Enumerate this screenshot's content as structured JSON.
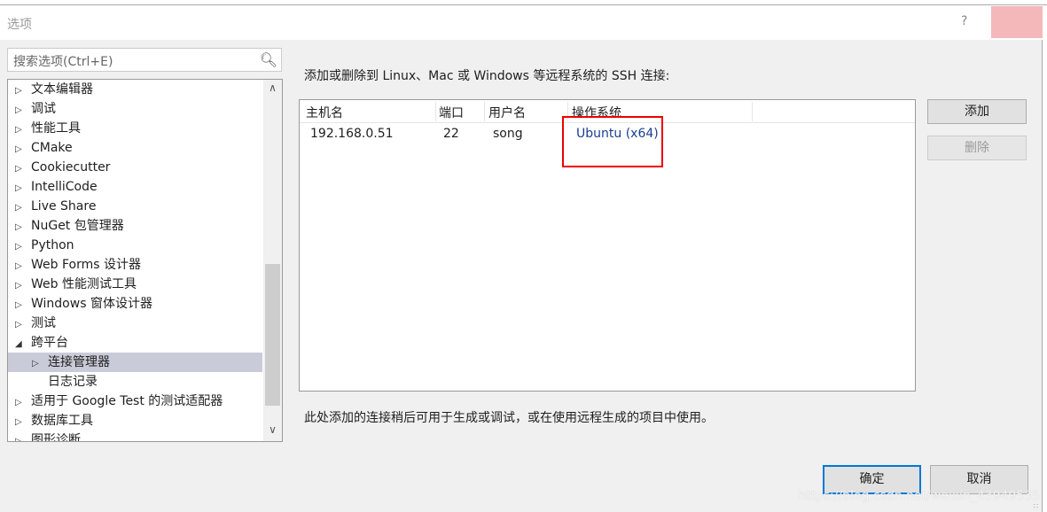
{
  "window": {
    "title": "选项",
    "help": "?"
  },
  "search": {
    "placeholder": "搜索选项(Ctrl+E)"
  },
  "tree": [
    {
      "label": "文本编辑器",
      "level": 1,
      "state": "collapsed"
    },
    {
      "label": "调试",
      "level": 1,
      "state": "collapsed"
    },
    {
      "label": "性能工具",
      "level": 1,
      "state": "collapsed"
    },
    {
      "label": "CMake",
      "level": 1,
      "state": "collapsed"
    },
    {
      "label": "Cookiecutter",
      "level": 1,
      "state": "collapsed"
    },
    {
      "label": "IntelliCode",
      "level": 1,
      "state": "collapsed"
    },
    {
      "label": "Live Share",
      "level": 1,
      "state": "collapsed"
    },
    {
      "label": "NuGet 包管理器",
      "level": 1,
      "state": "collapsed"
    },
    {
      "label": "Python",
      "level": 1,
      "state": "collapsed"
    },
    {
      "label": "Web Forms 设计器",
      "level": 1,
      "state": "collapsed"
    },
    {
      "label": "Web 性能测试工具",
      "level": 1,
      "state": "collapsed"
    },
    {
      "label": "Windows 窗体设计器",
      "level": 1,
      "state": "collapsed"
    },
    {
      "label": "测试",
      "level": 1,
      "state": "collapsed"
    },
    {
      "label": "跨平台",
      "level": 1,
      "state": "expanded"
    },
    {
      "label": "连接管理器",
      "level": 2,
      "state": "collapsed",
      "selected": true
    },
    {
      "label": "日志记录",
      "level": 2,
      "state": "none"
    },
    {
      "label": "适用于 Google Test 的测试适配器",
      "level": 1,
      "state": "collapsed"
    },
    {
      "label": "数据库工具",
      "level": 1,
      "state": "collapsed"
    },
    {
      "label": "图形诊断",
      "level": 1,
      "state": "collapsed"
    }
  ],
  "main": {
    "description": "添加或删除到 Linux、Mac 或 Windows 等远程系统的 SSH 连接:",
    "columns": [
      "主机名",
      "端口",
      "用户名",
      "操作系统"
    ],
    "rows": [
      [
        "192.168.0.51",
        "22",
        "song",
        "Ubuntu (x64)"
      ]
    ],
    "add_label": "添加",
    "remove_label": "删除",
    "note": "此处添加的连接稍后可用于生成或调试，或在使用远程生成的项目中使用。"
  },
  "footer": {
    "ok_label": "确定",
    "cancel_label": "取消"
  },
  "watermark": "https://blog.csdn.net/weixin_43949535"
}
